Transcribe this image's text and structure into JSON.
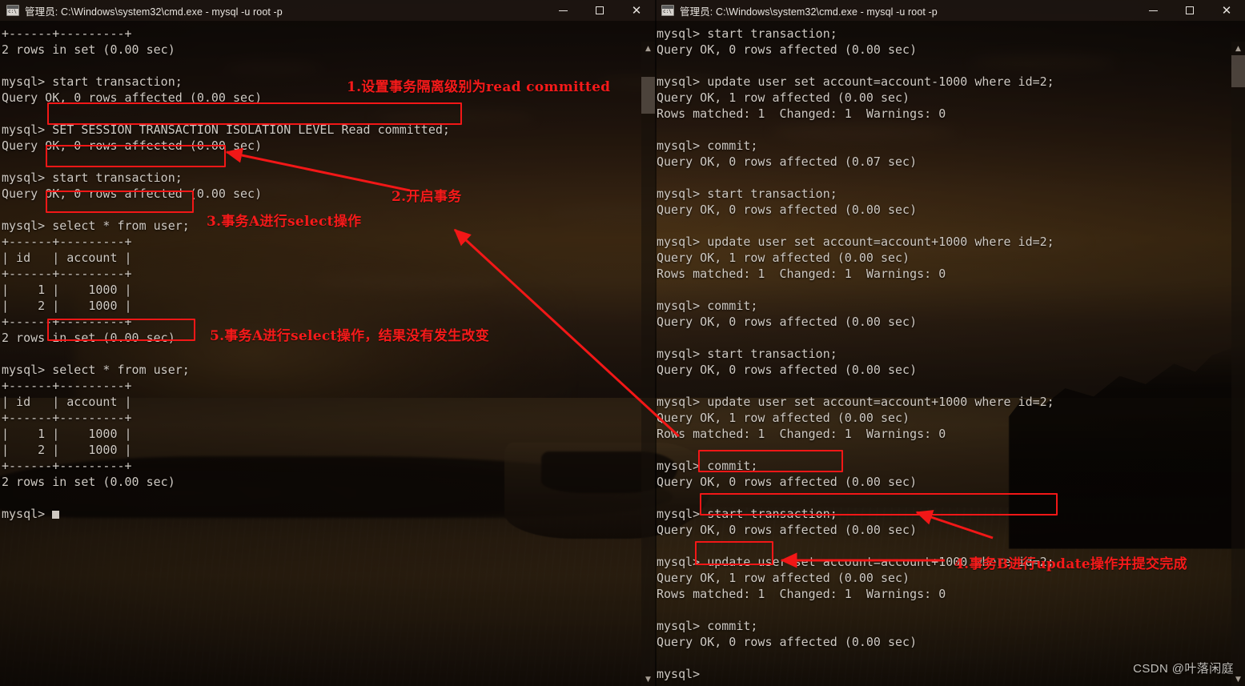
{
  "window_left": {
    "title": "管理员: C:\\Windows\\system32\\cmd.exe - mysql  -u root -p",
    "icon": "cmd-icon",
    "minimize_label": "─",
    "maximize_label": "□",
    "close_label": "✕",
    "lines": [
      "+------+---------+",
      "2 rows in set (0.00 sec)",
      "",
      "mysql> start transaction;",
      "Query OK, 0 rows affected (0.00 sec)",
      "",
      "mysql> SET SESSION TRANSACTION ISOLATION LEVEL Read committed;",
      "Query OK, 0 rows affected (0.00 sec)",
      "",
      "mysql> start transaction;",
      "Query OK, 0 rows affected (0.00 sec)",
      "",
      "mysql> select * from user;",
      "+------+---------+",
      "| id   | account |",
      "+------+---------+",
      "|    1 |    1000 |",
      "|    2 |    1000 |",
      "+------+---------+",
      "2 rows in set (0.00 sec)",
      "",
      "mysql> select * from user;",
      "+------+---------+",
      "| id   | account |",
      "+------+---------+",
      "|    1 |    1000 |",
      "|    2 |    1000 |",
      "+------+---------+",
      "2 rows in set (0.00 sec)",
      "",
      "mysql> "
    ]
  },
  "window_right": {
    "title": "管理员: C:\\Windows\\system32\\cmd.exe - mysql  -u root -p",
    "icon": "cmd-icon",
    "minimize_label": "─",
    "maximize_label": "□",
    "close_label": "✕",
    "lines": [
      "mysql> start transaction;",
      "Query OK, 0 rows affected (0.00 sec)",
      "",
      "mysql> update user set account=account-1000 where id=2;",
      "Query OK, 1 row affected (0.00 sec)",
      "Rows matched: 1  Changed: 1  Warnings: 0",
      "",
      "mysql> commit;",
      "Query OK, 0 rows affected (0.07 sec)",
      "",
      "mysql> start transaction;",
      "Query OK, 0 rows affected (0.00 sec)",
      "",
      "mysql> update user set account=account+1000 where id=2;",
      "Query OK, 1 row affected (0.00 sec)",
      "Rows matched: 1  Changed: 1  Warnings: 0",
      "",
      "mysql> commit;",
      "Query OK, 0 rows affected (0.00 sec)",
      "",
      "mysql> start transaction;",
      "Query OK, 0 rows affected (0.00 sec)",
      "",
      "mysql> update user set account=account+1000 where id=2;",
      "Query OK, 1 row affected (0.00 sec)",
      "Rows matched: 1  Changed: 1  Warnings: 0",
      "",
      "mysql> commit;",
      "Query OK, 0 rows affected (0.00 sec)",
      "",
      "mysql> start transaction;",
      "Query OK, 0 rows affected (0.00 sec)",
      "",
      "mysql> update user set account=account+1000 where id=2;",
      "Query OK, 1 row affected (0.00 sec)",
      "Rows matched: 1  Changed: 1  Warnings: 0",
      "",
      "mysql> commit;",
      "Query OK, 0 rows affected (0.00 sec)",
      "",
      "mysql>"
    ]
  },
  "annotations": {
    "note1": "1.设置事务隔离级别为read committed",
    "note2": "2.开启事务",
    "note3": "3.事务A进行select操作",
    "note4": "4.事务B进行update操作并提交完成",
    "note5": "5.事务A进行select操作，结果没有发生改变",
    "highlight_color": "#f21717",
    "text_color": "#f51a1a"
  },
  "watermark": "CSDN @叶落闲庭"
}
